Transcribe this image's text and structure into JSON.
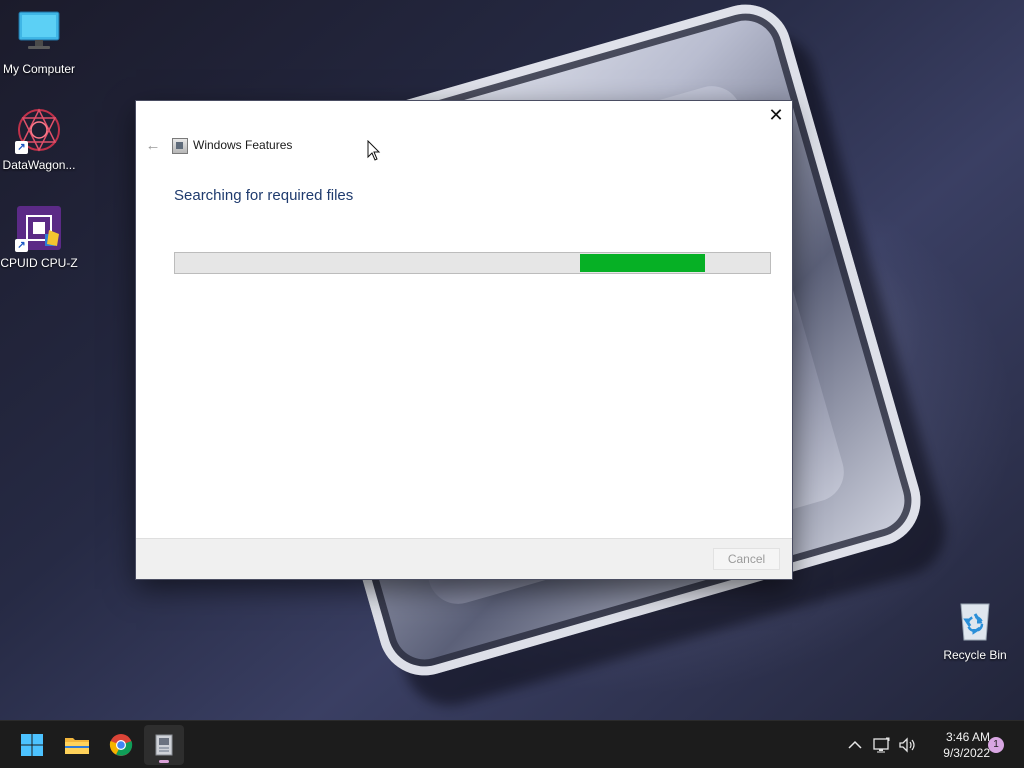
{
  "desktop": {
    "icons": [
      {
        "label": "My Computer"
      },
      {
        "label": "DataWagon..."
      },
      {
        "label": "CPUID CPU-Z"
      },
      {
        "label": "Recycle Bin"
      }
    ]
  },
  "dialog": {
    "title": "Windows Features",
    "heading": "Searching for required files",
    "progress": {
      "state": "indeterminate",
      "chunk_start": 0.68,
      "chunk_end": 0.89,
      "fill_color": "#06b025"
    },
    "cancel_label": "Cancel",
    "close_glyph": "✕",
    "back_glyph": "←"
  },
  "taskbar": {
    "apps": [
      {
        "icon": "windows-start-icon"
      },
      {
        "icon": "file-explorer-icon"
      },
      {
        "icon": "chrome-icon"
      },
      {
        "icon": "windows-features-icon",
        "active": true
      }
    ],
    "tray": {
      "chevron": "^",
      "time": "3:46 AM",
      "date": "9/3/2022",
      "notifications": "1"
    }
  },
  "colors": {
    "accent_heading": "#1f3b6e",
    "progress_green": "#06b025",
    "taskbar_bg": "#1c1c1c"
  }
}
